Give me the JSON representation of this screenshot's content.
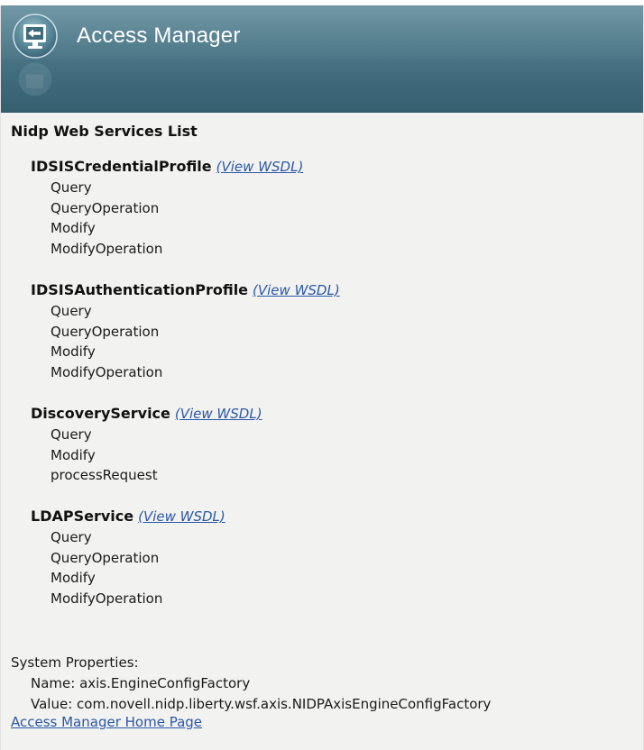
{
  "header": {
    "title": "Access Manager",
    "icon": "exit-screen-icon"
  },
  "page": {
    "title": "Nidp Web Services List"
  },
  "services": [
    {
      "name": "IDSISCredentialProfile",
      "wsdl_label": "(View WSDL)",
      "operations": [
        "Query",
        "QueryOperation",
        "Modify",
        "ModifyOperation"
      ]
    },
    {
      "name": "IDSISAuthenticationProfile",
      "wsdl_label": "(View WSDL)",
      "operations": [
        "Query",
        "QueryOperation",
        "Modify",
        "ModifyOperation"
      ]
    },
    {
      "name": "DiscoveryService",
      "wsdl_label": "(View WSDL)",
      "operations": [
        "Query",
        "Modify",
        "processRequest"
      ]
    },
    {
      "name": "LDAPService",
      "wsdl_label": "(View WSDL)",
      "operations": [
        "Query",
        "QueryOperation",
        "Modify",
        "ModifyOperation"
      ]
    }
  ],
  "system_properties": {
    "heading": "System Properties:",
    "name_line": "Name: axis.EngineConfigFactory",
    "value_line": "Value: com.novell.nidp.liberty.wsf.axis.NIDPAxisEngineConfigFactory"
  },
  "footer": {
    "home_link": "Access Manager Home Page"
  },
  "colors": {
    "header_bg": "#4f7b8b",
    "link": "#2a57a8",
    "page_bg": "#f2f2f0"
  }
}
